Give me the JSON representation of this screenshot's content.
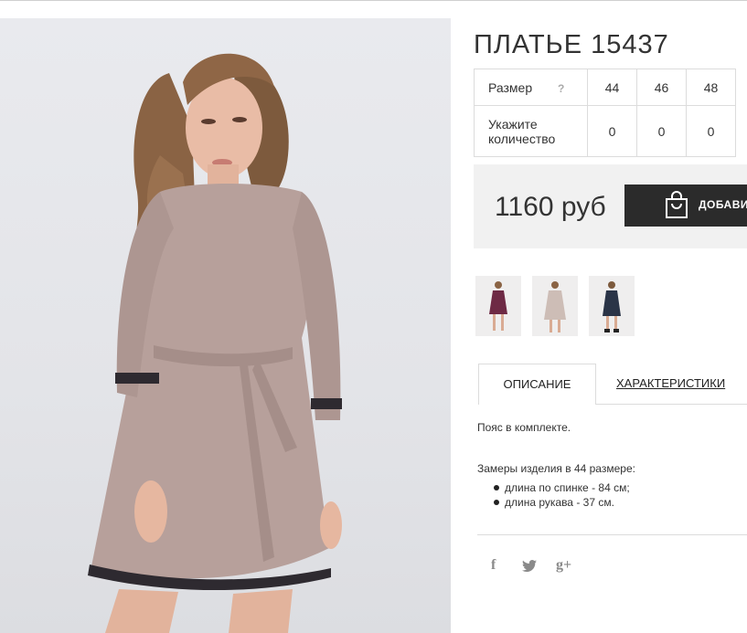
{
  "product": {
    "title": "ПЛАТЬЕ 15437"
  },
  "size_table": {
    "size_label": "Размер",
    "help_icon_text": "?",
    "sizes": [
      "44",
      "46",
      "48"
    ],
    "quantity_label": "Укажите количество",
    "quantities": [
      "0",
      "0",
      "0"
    ]
  },
  "purchase": {
    "price": "1160 руб",
    "add_button_label": "ДОБАВИТЬ"
  },
  "thumbnails": [
    {
      "color": "#6e2a45",
      "icon": "thumbnail-dress-burgundy"
    },
    {
      "color": "#cdbdb6",
      "icon": "thumbnail-dress-beige"
    },
    {
      "color": "#2a3447",
      "icon": "thumbnail-dress-navy"
    }
  ],
  "tabs": {
    "description": "ОПИСАНИЕ",
    "characteristics": "ХАРАКТЕРИСТИКИ"
  },
  "description": {
    "belt_note": "Пояс в комплекте.",
    "measure_intro": "Замеры изделия в 44 размере:",
    "measures": [
      "длина по спинке - 84 см;",
      "длина рукава - 37 см."
    ]
  },
  "social": {
    "facebook": "f",
    "twitter": "twitter-icon",
    "google_plus": "g+"
  },
  "colors": {
    "dress": "#b49e9a",
    "price_bg": "#f1f1f1",
    "button_bg": "#2b2b2b"
  }
}
